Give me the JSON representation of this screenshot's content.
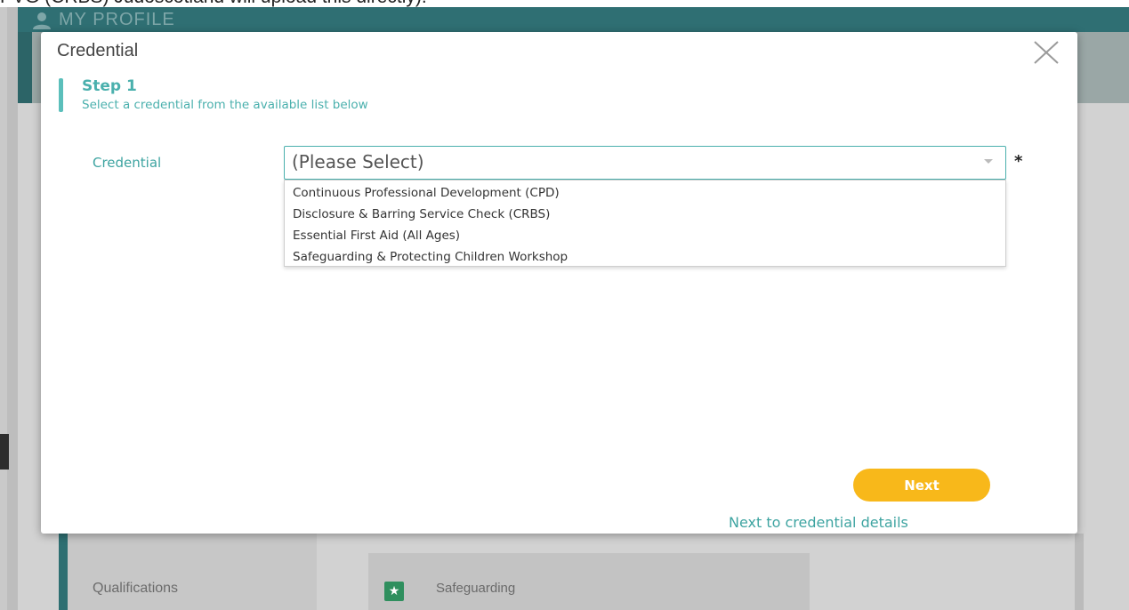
{
  "top_text": "PVG (CRBS) Judoscotland will upload this directly).",
  "background": {
    "header_title": "MY PROFILE",
    "sidebar_item": "Qualifications",
    "card_text": "Safeguarding",
    "colors": {
      "header": "#2f6f73",
      "accent": "#2e6f72"
    }
  },
  "modal": {
    "title": "Credential",
    "step": {
      "title": "Step 1",
      "description": "Select a credential from the available list below"
    },
    "field": {
      "label": "Credential",
      "selected_value": "(Please Select)",
      "required_mark": "*",
      "options": [
        "Continuous Professional Development (CPD)",
        "Disclosure & Barring Service Check (CRBS)",
        "Essential First Aid (All Ages)",
        "Safeguarding & Protecting Children Workshop"
      ]
    },
    "next_button_label": "Next",
    "next_hint": "Next to credential details",
    "colors": {
      "accent": "#4ab0ad",
      "button": "#f8b81a"
    }
  }
}
